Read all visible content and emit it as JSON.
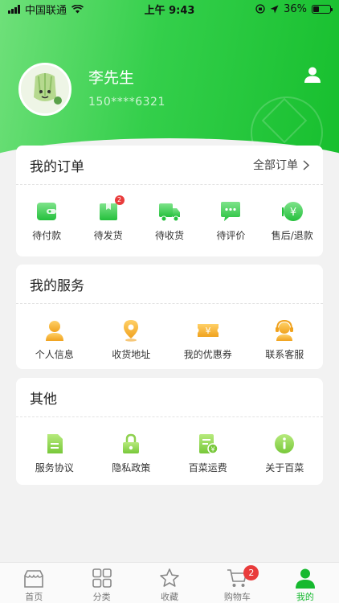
{
  "status_bar": {
    "carrier": "中国联通",
    "time": "上午 9:43",
    "battery": "36%",
    "battery_level": 0.36
  },
  "profile": {
    "name": "李先生",
    "phone": "150****6321"
  },
  "orders": {
    "title": "我的订单",
    "all_label": "全部订单",
    "items": [
      {
        "label": "待付款",
        "icon": "wallet-icon"
      },
      {
        "label": "待发货",
        "icon": "package-icon",
        "badge": "2"
      },
      {
        "label": "待收货",
        "icon": "truck-icon"
      },
      {
        "label": "待评价",
        "icon": "comment-icon"
      },
      {
        "label": "售后/退款",
        "icon": "refund-icon"
      }
    ]
  },
  "services": {
    "title": "我的服务",
    "items": [
      {
        "label": "个人信息",
        "icon": "user-info-icon"
      },
      {
        "label": "收货地址",
        "icon": "location-icon"
      },
      {
        "label": "我的优惠券",
        "icon": "coupon-icon"
      },
      {
        "label": "联系客服",
        "icon": "customer-service-icon"
      }
    ]
  },
  "other": {
    "title": "其他",
    "items": [
      {
        "label": "服务协议",
        "icon": "document-icon"
      },
      {
        "label": "隐私政策",
        "icon": "lock-icon"
      },
      {
        "label": "百菜运费",
        "icon": "shipping-fee-icon"
      },
      {
        "label": "关于百菜",
        "icon": "info-icon"
      }
    ]
  },
  "tabbar": {
    "items": [
      {
        "label": "首页",
        "icon": "home-icon"
      },
      {
        "label": "分类",
        "icon": "category-icon"
      },
      {
        "label": "收藏",
        "icon": "star-icon"
      },
      {
        "label": "购物车",
        "icon": "cart-icon",
        "badge": "2"
      },
      {
        "label": "我的",
        "icon": "profile-icon",
        "active": true
      }
    ]
  },
  "colors": {
    "brand_green": "#17bf2e",
    "badge_red": "#e93b3b",
    "coupon_yellow": "#f4b73a"
  }
}
